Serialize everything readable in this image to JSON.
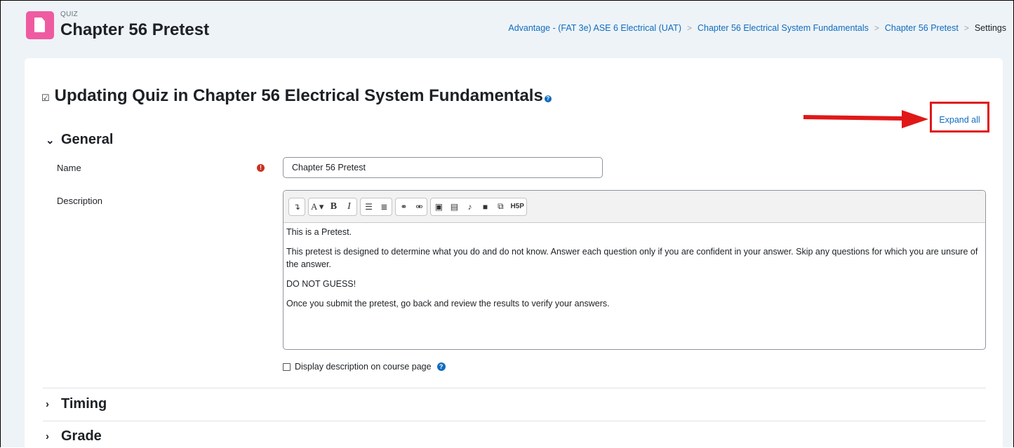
{
  "header": {
    "module_type": "QUIZ",
    "title": "Chapter 56 Pretest",
    "breadcrumb": [
      "Advantage - (FAT 3e) ASE 6 Electrical (UAT)",
      "Chapter 56 Electrical System Fundamentals",
      "Chapter 56 Pretest",
      "Settings"
    ]
  },
  "main": {
    "heading": "Updating Quiz in Chapter 56 Electrical System Fundamentals",
    "expand_all": "Expand all",
    "sections": {
      "general": "General",
      "timing": "Timing",
      "grade": "Grade"
    },
    "name_label": "Name",
    "name_value": "Chapter 56 Pretest",
    "description_label": "Description",
    "description": [
      "This is a Pretest.",
      "This pretest is designed to determine what you do and do not know. Answer each question only if you are confident in your answer. Skip any questions for which you are unsure of the answer.",
      "DO NOT GUESS!",
      "Once you submit the pretest, go back and review the results to verify your answers."
    ],
    "display_description_label": "Display description on course page"
  },
  "toolbar": {
    "text_buttons": {
      "font": "A ▾",
      "bold": "B",
      "italic": "I",
      "h5p": "H5P"
    }
  },
  "colors": {
    "quiz_icon": "#ef5ba1",
    "link": "#0f6cbf",
    "highlight": "#e01818",
    "required": "#ca3120"
  }
}
